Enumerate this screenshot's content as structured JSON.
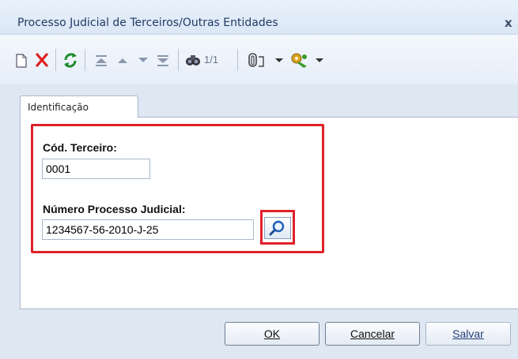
{
  "window": {
    "title": "Processo Judicial de Terceiros/Outras Entidades",
    "close_label": "x"
  },
  "toolbar": {
    "icons": [
      "new-document-icon",
      "delete-icon",
      "refresh-icon",
      "first-record-icon",
      "previous-record-icon",
      "next-record-icon",
      "last-record-icon",
      "search-icon",
      "attachment-icon",
      "chevron-down-icon",
      "tools-icon",
      "chevron-down-icon"
    ],
    "record_counter": "1/1"
  },
  "tabs": [
    {
      "label": "Identificação"
    }
  ],
  "form": {
    "cod_terceiro": {
      "label": "Cód. Terceiro:",
      "value": "0001"
    },
    "numero_processo": {
      "label": "Número Processo Judicial:",
      "value": "1234567-56-2010-J-25"
    }
  },
  "buttons": {
    "ok": "OK",
    "cancel": "Cancelar",
    "save": "Salvar"
  },
  "colors": {
    "highlight": "#e0202a",
    "title_text": "#223a63",
    "delete_icon": "#e02020",
    "refresh_icon": "#1f8a2c"
  }
}
